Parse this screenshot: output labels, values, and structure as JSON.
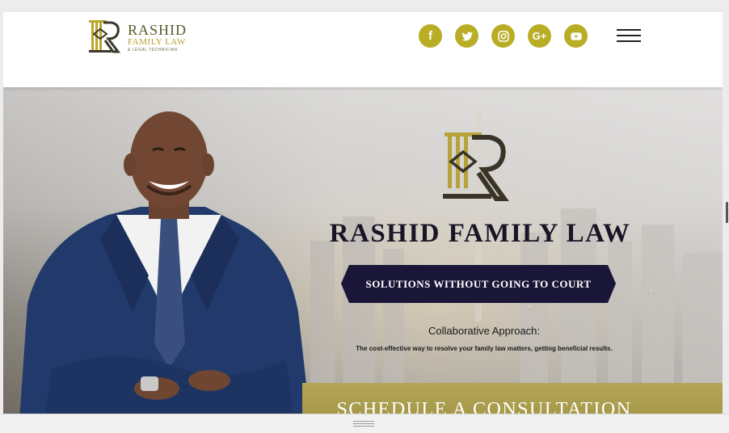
{
  "header": {
    "logo": {
      "name": "RASHID",
      "subtitle": "FAMILY LAW",
      "tagline": "& LEGAL TECHNICIAN"
    },
    "social": [
      {
        "name": "facebook-icon",
        "glyph": "f"
      },
      {
        "name": "twitter-icon",
        "glyph": ""
      },
      {
        "name": "instagram-icon",
        "glyph": ""
      },
      {
        "name": "google-plus-icon",
        "glyph": "G+"
      },
      {
        "name": "youtube-icon",
        "glyph": ""
      }
    ],
    "menu_icon": "hamburger-menu-icon"
  },
  "hero": {
    "title": "RASHID FAMILY LAW",
    "banner": "SOLUTIONS WITHOUT GOING TO COURT",
    "approach_title": "Collaborative Approach:",
    "approach_subtitle": "The cost-effective way to resolve your family law matters, getting beneficial results.",
    "cta": "SCHEDULE A CONSULTATION"
  },
  "colors": {
    "gold": "#b9ad25",
    "navy": "#1a1526",
    "cta_gold": "#a99c4c"
  }
}
